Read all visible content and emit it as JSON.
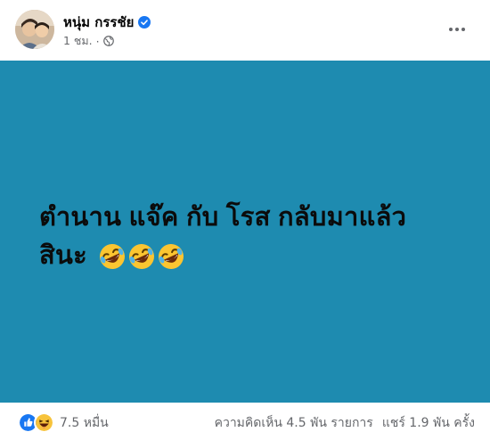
{
  "post": {
    "author": "หนุ่ม กรรชัย",
    "time": "1 ชม.",
    "separator": "·",
    "banner_line1": "ตำนาน แจ๊ค กับ โรส กลับมาแล้ว",
    "banner_line2": "สินะ",
    "banner_color": "#1e8bb0",
    "emojis": [
      "rolling-on-floor-laughing",
      "rolling-on-floor-laughing",
      "rolling-on-floor-laughing"
    ]
  },
  "footer": {
    "reactions": [
      "like",
      "haha"
    ],
    "reaction_count": "7.5 หมื่น",
    "comments": "ความคิดเห็น 4.5 พัน รายการ",
    "shares": "แชร์ 1.9 พัน ครั้ง"
  },
  "colors": {
    "accent": "#1877f2",
    "muted": "#65676b"
  }
}
